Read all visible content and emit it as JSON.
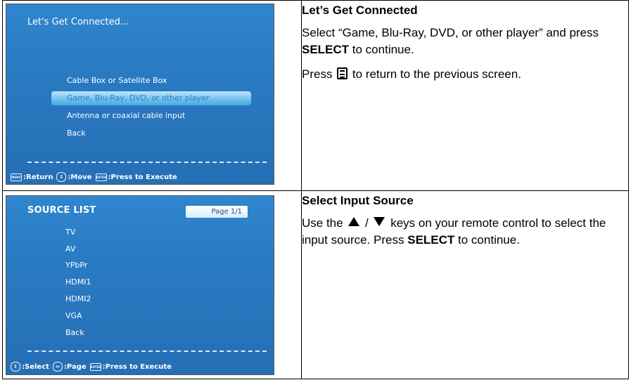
{
  "screen1": {
    "title": "Let's Get Connected...",
    "items": [
      {
        "label": "Cable Box or Satellite Box",
        "selected": false
      },
      {
        "label": "Game, Blu-Ray, DVD, or other player",
        "selected": true
      },
      {
        "label": "Antenna or coaxial cable input",
        "selected": false
      },
      {
        "label": "Back",
        "selected": false
      }
    ],
    "footer": {
      "menu_key": "MENU",
      "return_label": ":Return",
      "move_label": ":Move",
      "enter_key": "ENTER",
      "execute_label": ":Press to Execute"
    }
  },
  "screen2": {
    "title": "SOURCE LIST",
    "page_indicator": "Page 1/1",
    "items": [
      {
        "label": "TV",
        "selected": true
      },
      {
        "label": "AV",
        "selected": false
      },
      {
        "label": "YPbPr",
        "selected": false
      },
      {
        "label": "HDMI1",
        "selected": false
      },
      {
        "label": "HDMI2",
        "selected": false
      },
      {
        "label": "VGA",
        "selected": false
      },
      {
        "label": "Back",
        "selected": false
      }
    ],
    "footer": {
      "select_label": ":Select",
      "page_label": ":Page",
      "enter_key": "ENTER",
      "execute_label": ":Press to Execute"
    }
  },
  "section1": {
    "heading": "Let’s Get Connected",
    "para1_start": "Select “Game, Blu-Ray, DVD, or other player” and press ",
    "para1_bold": "SELECT",
    "para1_end": " to continue.",
    "para2_start": "Press ",
    "para2_end": " to return to the previous screen.",
    "menu_icon": "menu-button-icon"
  },
  "section2": {
    "heading": "Select Input Source",
    "para1_start": "Use the ",
    "para1_mid": " / ",
    "para1_after_icons": " keys on your remote control to select the input source. Press ",
    "para1_bold": "SELECT",
    "para1_end": " to continue.",
    "up_icon": "up-arrow-icon",
    "down_icon": "down-arrow-icon"
  }
}
